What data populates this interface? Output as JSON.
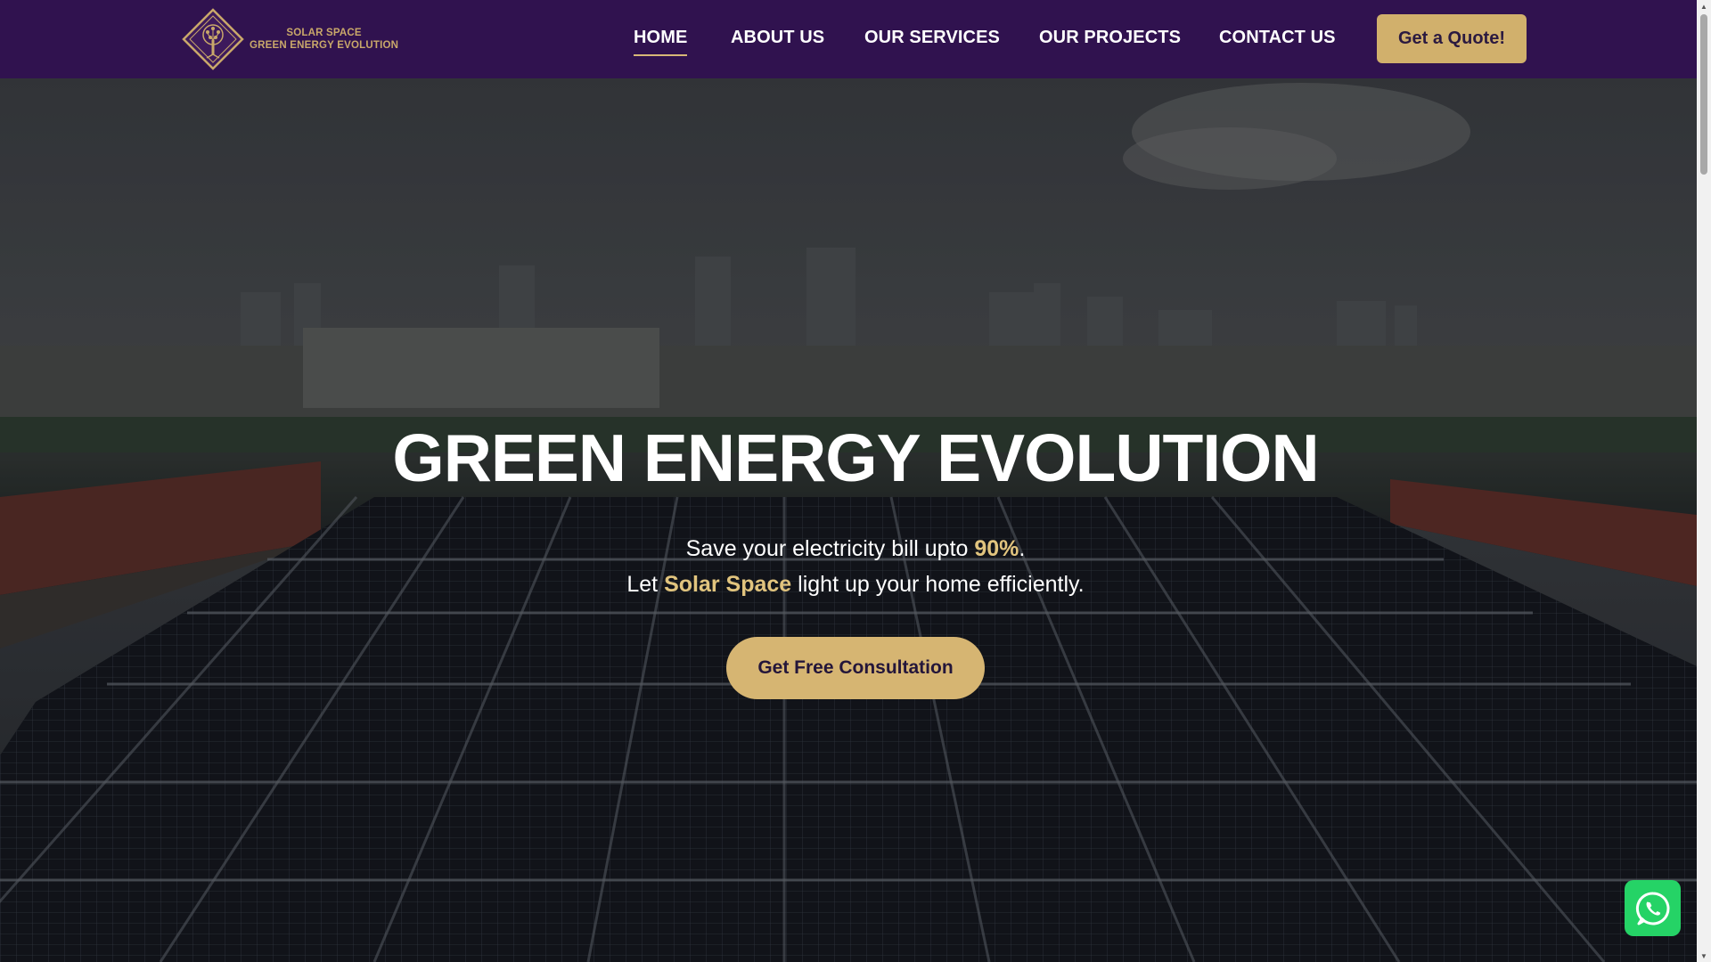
{
  "brand": {
    "line1": "SOLAR  SPACE",
    "line2": "GREEN ENERGY EVOLUTION",
    "logo_icon": "tree-diamond-logo",
    "gold": "#c9a86a"
  },
  "nav": {
    "items": [
      {
        "label": "HOME",
        "active": true
      },
      {
        "label": "ABOUT US",
        "active": false
      },
      {
        "label": "OUR SERVICES",
        "active": false
      },
      {
        "label": "OUR PROJECTS",
        "active": false
      },
      {
        "label": "CONTACT US",
        "active": false
      }
    ],
    "cta": "Get a Quote!",
    "background": "#30124f"
  },
  "hero": {
    "title": "GREEN ENERGY EVOLUTION",
    "line1_pre": "Save your electricity bill upto ",
    "line1_highlight": "90%",
    "line1_post": ".",
    "line2_pre": "Let ",
    "line2_highlight": "Solar Space",
    "line2_post": " light up your home efficiently.",
    "cta": "Get Free Consultation",
    "accent": "#d6b572"
  },
  "floating": {
    "whatsapp_icon": "whatsapp-icon",
    "color": "#25d366"
  }
}
